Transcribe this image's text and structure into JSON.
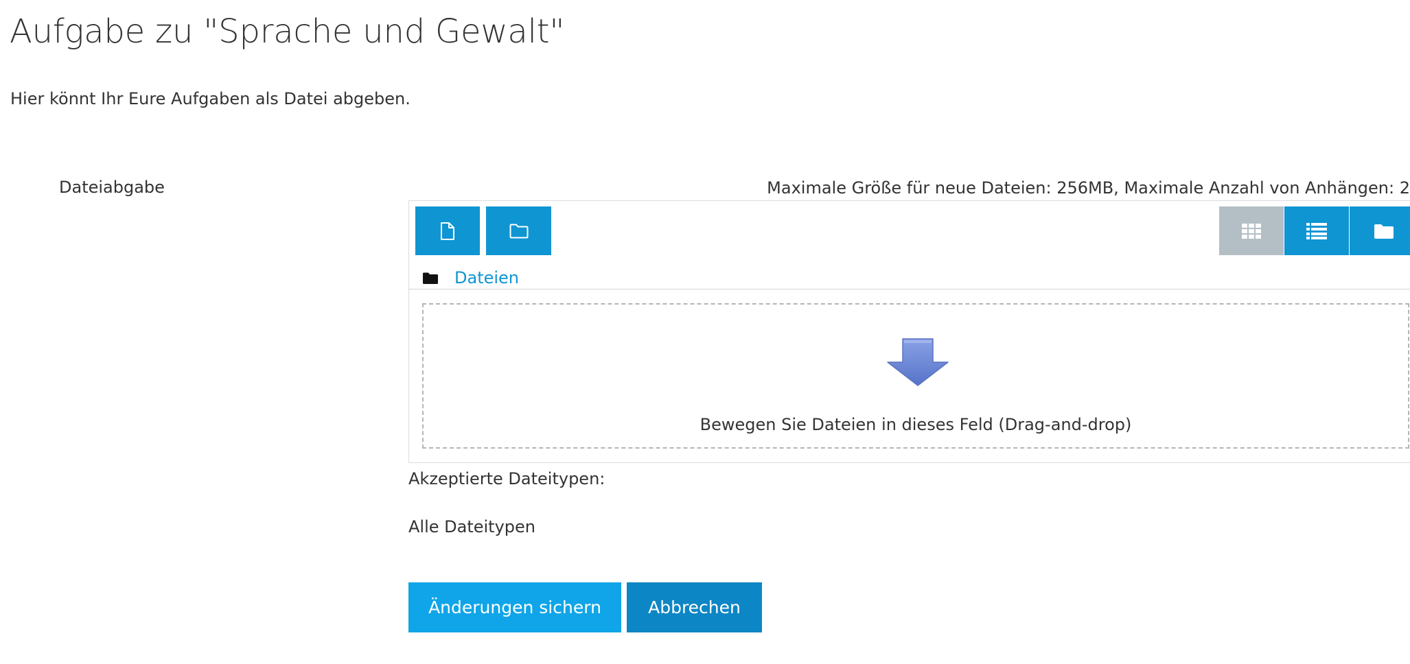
{
  "page": {
    "title": "Aufgabe zu \"Sprache und Gewalt\"",
    "intro": "Hier könnt Ihr Eure Aufgaben als Datei abgeben."
  },
  "form": {
    "field_label": "Dateiabgabe",
    "limits_text": "Maximale Größe für neue Dateien: 256MB, Maximale Anzahl von Anhängen: 2",
    "accepted_label": "Akzeptierte Dateitypen:",
    "accepted_value": "Alle Dateitypen"
  },
  "filemanager": {
    "toolbar": {
      "add_file_icon": "file-icon",
      "new_folder_icon": "folder-outline-icon"
    },
    "view_modes": [
      {
        "icon": "grid-icon",
        "active": true
      },
      {
        "icon": "list-icon",
        "active": false
      },
      {
        "icon": "folder-icon",
        "active": false
      }
    ],
    "breadcrumb": "Dateien",
    "dropzone_text": "Bewegen Sie Dateien in dieses Feld (Drag-and-drop)"
  },
  "buttons": {
    "save": "Änderungen sichern",
    "cancel": "Abbrechen"
  },
  "colors": {
    "primary": "#0f95d2",
    "save_button": "#10a5e8",
    "cancel_button": "#0d86c5",
    "active_view": "#b3bec5",
    "arrow": "#6b87d6"
  }
}
